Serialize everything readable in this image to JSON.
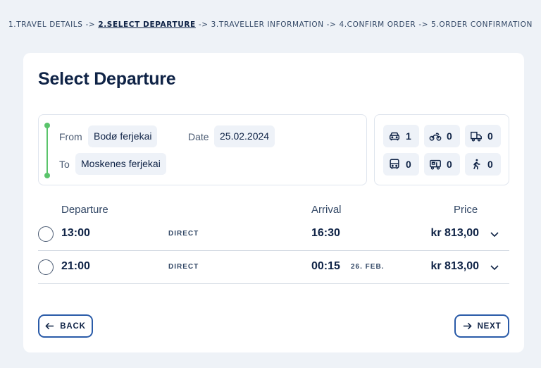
{
  "breadcrumb": {
    "steps": [
      "1.TRAVEL DETAILS",
      "2.SELECT DEPARTURE",
      "3.TRAVELLER INFORMATION",
      "4.CONFIRM ORDER",
      "5.ORDER CONFIRMATION"
    ],
    "separator": "->",
    "active_index": 1
  },
  "title": "Select Departure",
  "route": {
    "from_label": "From",
    "from_value": "Bodø ferjekai",
    "to_label": "To",
    "to_value": "Moskenes ferjekai",
    "date_label": "Date",
    "date_value": "25.02.2024"
  },
  "passengers": {
    "car": "1",
    "motorcycle": "0",
    "truck": "0",
    "bus": "0",
    "camper": "0",
    "pedestrian": "0"
  },
  "table": {
    "headers": {
      "departure": "Departure",
      "arrival": "Arrival",
      "price": "Price"
    },
    "rows": [
      {
        "departure": "13:00",
        "type": "DIRECT",
        "arrival": "16:30",
        "arrival_date": "",
        "price": "kr 813,00"
      },
      {
        "departure": "21:00",
        "type": "DIRECT",
        "arrival": "00:15",
        "arrival_date": "26. FEB.",
        "price": "kr 813,00"
      }
    ]
  },
  "buttons": {
    "back": "BACK",
    "next": "NEXT"
  },
  "colors": {
    "accent": "#2a5ba8",
    "route_line": "#5ac46b",
    "text": "#0f2346"
  }
}
